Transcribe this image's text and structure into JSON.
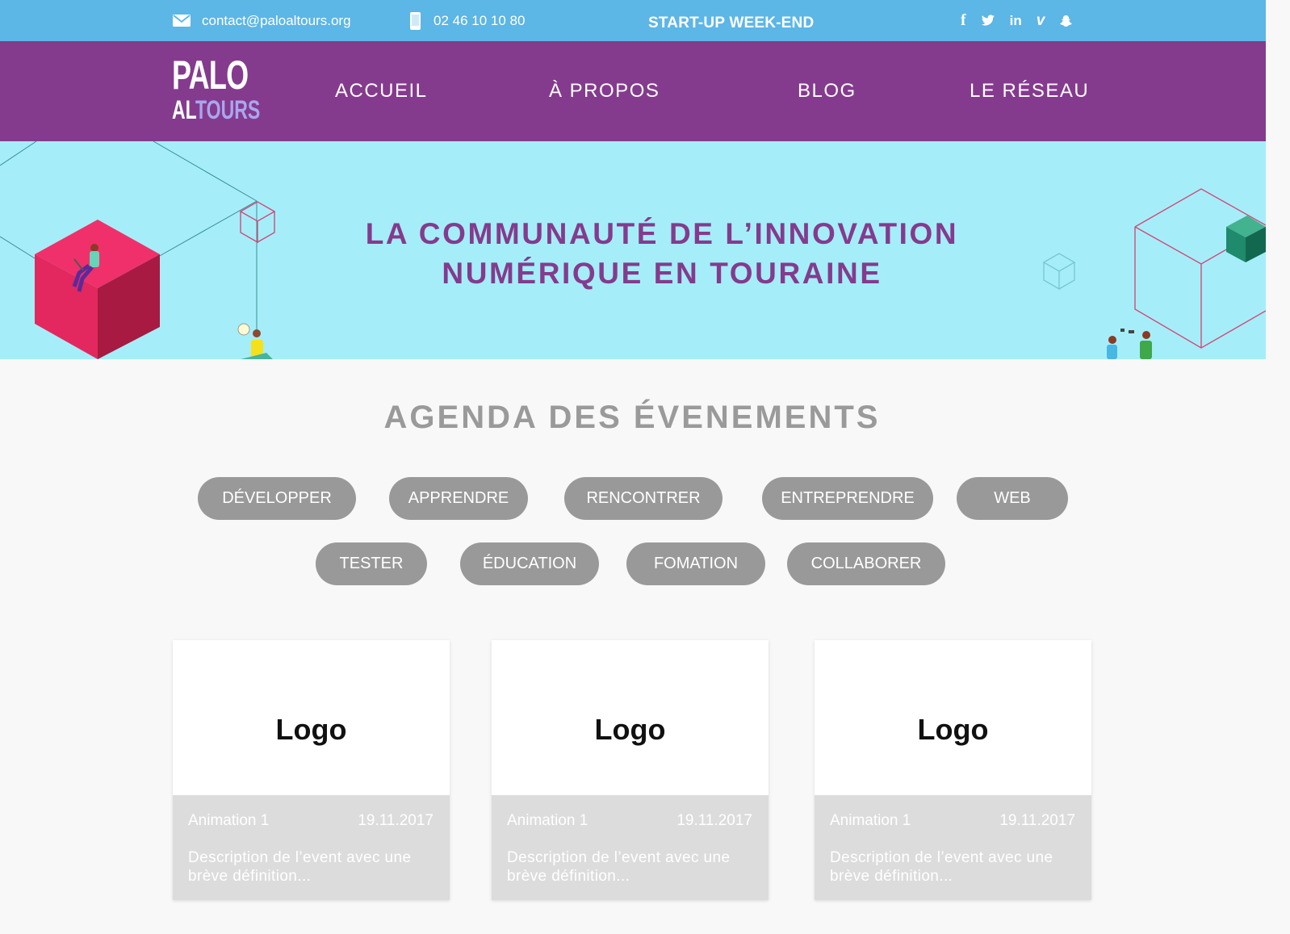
{
  "topbar": {
    "email": "contact@paloaltours.org",
    "phone": "02 46 10 10 80",
    "startup": "START-UP WEEK-END",
    "socials": [
      {
        "icon": "facebook-icon",
        "glyph": "f"
      },
      {
        "icon": "twitter-icon",
        "glyph": "🐦"
      },
      {
        "icon": "linkedin-icon",
        "glyph": "in"
      },
      {
        "icon": "vimeo-icon",
        "glyph": "v"
      },
      {
        "icon": "snapchat-icon",
        "glyph": "👻"
      }
    ]
  },
  "nav": {
    "logo_line1": "PALO",
    "logo_line2_a": "AL",
    "logo_line2_b": "TOURS",
    "links": [
      "ACCUEIL",
      "À PROPOS",
      "BLOG",
      "LE RÉSEAU"
    ]
  },
  "hero": {
    "title_line1": "LA COMMUNAUTÉ DE L’INNOVATION",
    "title_line2": "NUMÉRIQUE EN TOURAINE"
  },
  "agenda": {
    "title": "AGENDA DES ÉVENEMENTS",
    "tags_row1": [
      "DÉVELOPPER",
      "APPRENDRE",
      "RENCONTRER",
      "ENTREPRENDRE",
      "WEB"
    ],
    "tags_row2": [
      "TESTER",
      "ÉDUCATION",
      "FOMATION",
      "COLLABORER"
    ]
  },
  "cards": [
    {
      "logo": "Logo",
      "name": "Animation 1",
      "date": "19.11.2017",
      "desc": "Description de l’event avec une brève définition..."
    },
    {
      "logo": "Logo",
      "name": "Animation 1",
      "date": "19.11.2017",
      "desc": "Description de l’event avec une brève définition..."
    },
    {
      "logo": "Logo",
      "name": "Animation 1",
      "date": "19.11.2017",
      "desc": "Description de l’event avec une brève définition..."
    }
  ],
  "colors": {
    "topbar": "#5cb6e6",
    "nav": "#843b8d",
    "hero": "#a5eef9",
    "tag": "#999999",
    "card_info": "#dcdcdc"
  }
}
